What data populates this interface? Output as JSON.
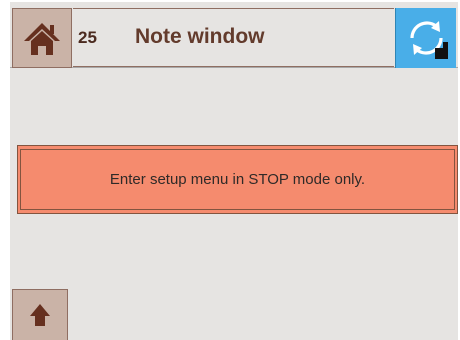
{
  "header": {
    "page_number": "25",
    "title": "Note window",
    "home_icon": "home-icon",
    "refresh_icon": "refresh-icon"
  },
  "note": {
    "message": "Enter setup menu in STOP mode only."
  },
  "footer": {
    "up_icon": "arrow-up-icon"
  },
  "colors": {
    "background": "#e6e4e2",
    "button_tan": "#cab3a7",
    "icon_brown": "#66301f",
    "title_brown": "#633b2c",
    "note_background": "#f58b6e",
    "note_border": "#83543f",
    "refresh_blue": "#49aee8"
  }
}
